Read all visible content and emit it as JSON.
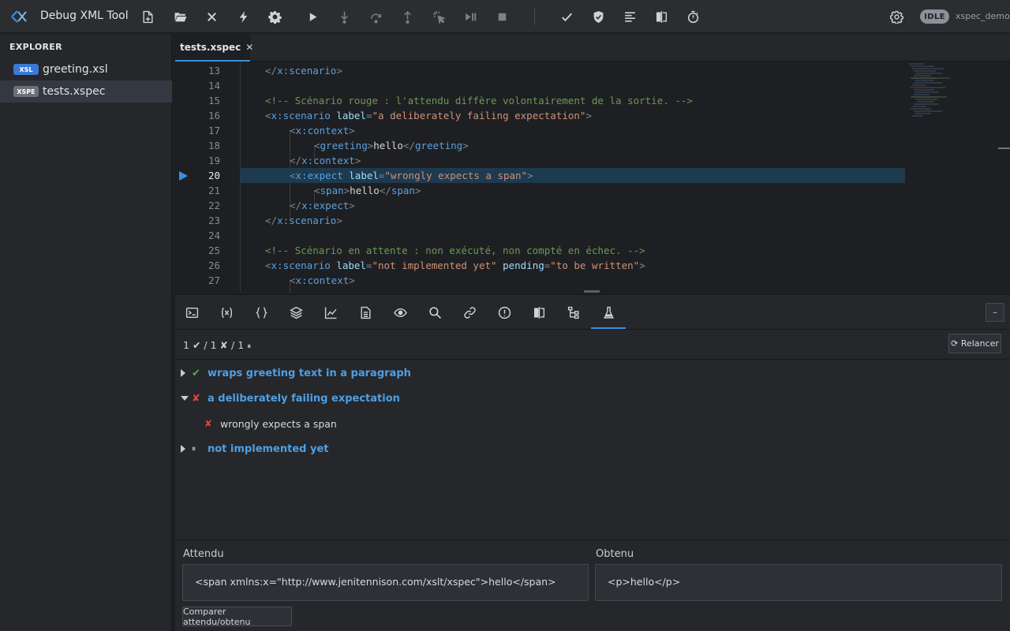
{
  "app": {
    "title": "Debug XML Tool",
    "status": "IDLE",
    "project": "xspec_demo"
  },
  "toolbar": {
    "buttons": [
      "new-file",
      "open-folder",
      "close",
      "transform",
      "settings",
      "run",
      "step-into",
      "step-over",
      "step-out",
      "run-to-cursor",
      "continue",
      "stop",
      "validate",
      "schema-check",
      "format",
      "compare",
      "timer"
    ],
    "right_settings": "settings"
  },
  "explorer": {
    "title": "EXPLORER",
    "files": [
      {
        "badge": "XSL",
        "name": "greeting.xsl",
        "active": false
      },
      {
        "badge": "XSPE",
        "name": "tests.xspec",
        "active": true
      }
    ]
  },
  "editor": {
    "tab_label": "tests.xspec",
    "tab_close": "✕",
    "current_line": 20,
    "lines": [
      {
        "no": "13"
      },
      {
        "no": "14"
      },
      {
        "no": "15"
      },
      {
        "no": "16"
      },
      {
        "no": "17"
      },
      {
        "no": "18"
      },
      {
        "no": "19"
      },
      {
        "no": "20"
      },
      {
        "no": "21"
      },
      {
        "no": "22"
      },
      {
        "no": "23"
      },
      {
        "no": "24"
      },
      {
        "no": "25"
      },
      {
        "no": "26"
      },
      {
        "no": "27"
      }
    ],
    "code": {
      "l13_tag": "x:scenario",
      "l15_comment": "<!-- Scénario rouge : l'attendu diffère volontairement de la sortie. -->",
      "l16_tag": "x:scenario",
      "l16_attr": "label",
      "l16_val": "\"a deliberately failing expectation\"",
      "l17_tag": "x:context",
      "l18_tag": "greeting",
      "l18_text": "hello",
      "l19_tag": "x:context",
      "l20_tag": "x:expect",
      "l20_attr": "label",
      "l20_val": "\"wrongly expects a span\"",
      "l21_tag": "span",
      "l21_text": "hello",
      "l22_tag": "x:expect",
      "l23_tag": "x:scenario",
      "l25_comment": "<!-- Scénario en attente : non exécuté, non compté en échec. -->",
      "l26_tag": "x:scenario",
      "l26_attr1": "label",
      "l26_val1": "\"not implemented yet\"",
      "l26_attr2": "pending",
      "l26_val2": "\"to be written\"",
      "l27_tag": "x:context"
    }
  },
  "panel": {
    "tabs": [
      "terminal",
      "variables",
      "json",
      "layers",
      "chart",
      "document",
      "watch",
      "search",
      "link",
      "problems",
      "compare",
      "tree",
      "tests"
    ],
    "active_tab": "tests",
    "collapse_label": "–",
    "summary": {
      "passed": "1",
      "failed": "1",
      "pending": "1",
      "pass_mark": "✔",
      "fail_mark": "✘",
      "pending_mark": "⏸",
      "sep": "/"
    },
    "rerun_label": "⟳ Relancer",
    "scenarios": [
      {
        "label": "wraps greeting text in a paragraph",
        "status": "pass",
        "icon": "✔",
        "expanded": false
      },
      {
        "label": "a deliberately failing expectation",
        "status": "fail",
        "icon": "✘",
        "expanded": true,
        "expects": [
          {
            "label": "wrongly expects a span",
            "icon": "✘"
          }
        ]
      },
      {
        "label": "not implemented yet",
        "status": "pending",
        "icon": "⏸",
        "expanded": false
      }
    ],
    "compare": {
      "expected_label": "Attendu",
      "actual_label": "Obtenu",
      "expected_value": "<span xmlns:x=\"http://www.jenitennison.com/xslt/xspec\">hello</span>",
      "actual_value": "<p>hello</p>",
      "button_label": "Comparer attendu/obtenu"
    }
  },
  "colors": {
    "accent": "#3b8fe0",
    "pass": "#4caf50",
    "fail": "#e0453a",
    "scenario_link": "#4f9fe3"
  }
}
